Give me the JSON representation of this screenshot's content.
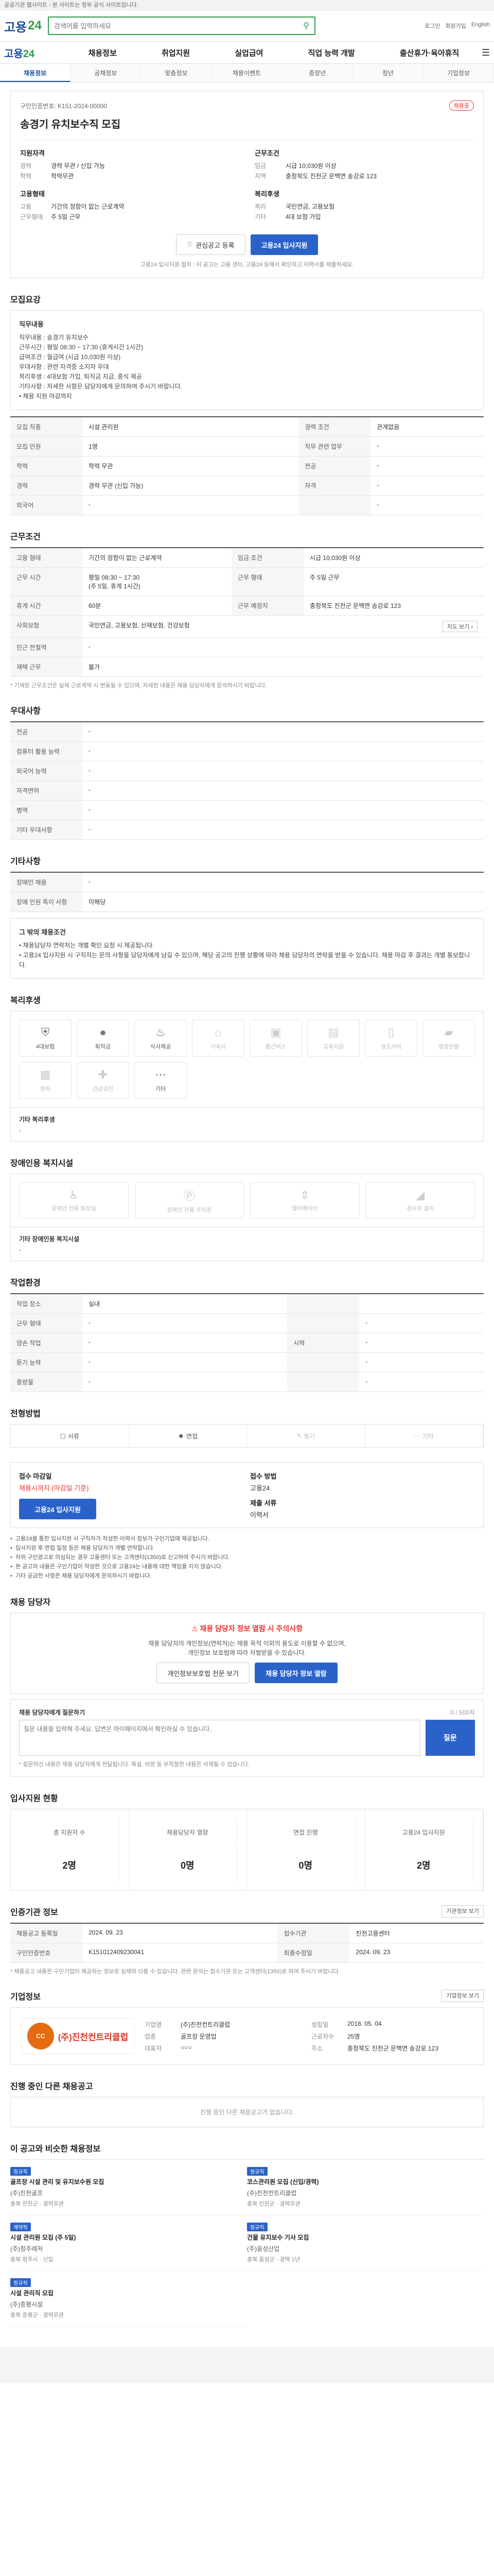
{
  "banner": "공공기관 웹사이트 - 본 사이트는 정부 공식 사이트입니다.",
  "header": {
    "logo_a": "고용",
    "logo_b": "24",
    "search_placeholder": "검색어를 입력하세요",
    "util": [
      "로그인",
      "회원가입",
      "English"
    ]
  },
  "gnb": {
    "items": [
      "채용정보",
      "취업지원",
      "실업급여",
      "직업 능력 개발",
      "출산휴가·육아휴직"
    ]
  },
  "tabs": [
    "채용정보",
    "공채정보",
    "맞춤정보",
    "채용이벤트",
    "중장년",
    "청년",
    "기업정보"
  ],
  "job": {
    "breadcrumb": "구인인증번호: K151-2024-00000",
    "status": "채용중",
    "title": "송경기 유치보수직 모집",
    "left_h": "지원자격",
    "left": [
      [
        "경력",
        "경력 무관 / 신입 가능"
      ],
      [
        "학력",
        "학력무관"
      ]
    ],
    "right_h": "근무조건",
    "right": [
      [
        "임금",
        "시급 10,030원 이상"
      ],
      [
        "지역",
        "충청북도 진천군 문백면 송강로 123"
      ]
    ],
    "left_h2": "고용형태",
    "left2": [
      [
        "고용",
        "기간의 정함이 없는 근로계약"
      ],
      [
        "근무형태",
        "주 5일 근무"
      ]
    ],
    "right_h2": "복리후생",
    "right2": [
      [
        "복리",
        "국민연금, 고용보험"
      ],
      [
        "기타",
        "4대 보험 가입"
      ]
    ],
    "btn_save": "관심공고 등록",
    "btn_apply": "고용24 입사지원",
    "note": "고용24 입사지원 절차 : 이 공고는 고용 센터, 고용24 등에서 확인하고 이력서를 제출하세요."
  },
  "recruit": {
    "title": "모집요강",
    "box_label": "직무내용",
    "box_text": "직무내용 : 송경기 유치보수\n근무시간 : 평일 08:30 ~ 17:30 (휴게시간 1시간)\n급여조건 : 월급여 (시급 10,030원 이상)\n우대사항 : 관련 자격증 소지자 우대\n복리후생 : 4대보험 가입, 퇴직금 지급, 중식 제공\n기타사항 : 자세한 사항은 담당자에게 문의하여 주시기 바랍니다.\n   • 채용 지원 마감까지",
    "rows": [
      [
        "모집 직종",
        "시설 관리원",
        "경력 조건",
        "관계없음"
      ],
      [
        "모집 인원",
        "1명",
        "직무 관련 업무",
        "-"
      ],
      [
        "학력",
        "학력 무관",
        "전공",
        "-"
      ],
      [
        "경력",
        "경력 무관 (신입 가능)",
        "자격",
        "-"
      ],
      [
        "외국어",
        "-",
        "",
        "-"
      ]
    ]
  },
  "work": {
    "title": "근무조건",
    "rows": [
      [
        "고용 형태",
        "기간의 정함이 없는 근로계약",
        "임금 조건",
        "시급 10,030원 이상"
      ],
      [
        "근무 시간",
        "평일 08:30 ~ 17:30\n(주 5일, 휴게 1시간)",
        "근무 형태",
        "주 5일 근무"
      ],
      [
        "휴게 시간",
        "60분",
        "근무 예정지",
        "충청북도 진천군 문백면 송강로 123"
      ],
      [
        "사회보험",
        "국민연금, 고용보험, 산재보험, 건강보험",
        "퇴직급여",
        "퇴직금"
      ],
      [
        "인근 전철역",
        "-",
        "",
        ""
      ],
      [
        "재택 근무",
        "불가",
        "",
        ""
      ]
    ],
    "note": "* 기재된 근무조건은 실제 근로계약 시 변동될 수 있으며, 자세한 내용은 채용 담당자에게 문의하시기 바랍니다."
  },
  "pref": {
    "title": "우대사항",
    "rows": [
      [
        "전공",
        "-"
      ],
      [
        "컴퓨터 활용 능력",
        "-"
      ],
      [
        "외국어 능력",
        "-"
      ],
      [
        "자격면허",
        "-"
      ],
      [
        "병역",
        "-"
      ],
      [
        "기타 우대사항",
        "-"
      ]
    ]
  },
  "etc": {
    "title": "기타사항",
    "rows": [
      [
        "장애인 채용",
        "-"
      ],
      [
        "장애 인원 특이 사항",
        "미해당"
      ]
    ]
  },
  "other": {
    "label": "그 밖의 채용조건",
    "text": "• 채용담당자 연락처는 개별 확인 요청 시 제공됩니다.\n• 고용24 입사지원 시 구직자는 문의 사항을 담당자에게 남길 수 있으며, 해당 공고의 진행 상황에 따라 채용 담당자의 연락을 받을 수 있습니다. 채용 마감 후 결과는 개별 통보합니다."
  },
  "welfare": {
    "title": "복리후생",
    "items": [
      [
        "4대보험",
        "on"
      ],
      [
        "퇴직금",
        "on"
      ],
      [
        "식사제공",
        "on"
      ],
      [
        "기숙사",
        "off"
      ],
      [
        "통근버스",
        "off"
      ],
      [
        "교육지원",
        "off"
      ],
      [
        "경조사비",
        "off"
      ],
      [
        "명절선물",
        "off"
      ],
      [
        "연차",
        "off"
      ],
      [
        "건강검진",
        "off"
      ],
      [
        "기타",
        "on"
      ]
    ],
    "sub_label": "기타 복리후생",
    "sub_text": "-"
  },
  "disability": {
    "title": "장애인용 복지시설",
    "items": [
      "장애인 전용 화장실",
      "장애인 전용 주차장",
      "엘리베이터",
      "경사로 설치"
    ],
    "sub_label": "기타 장애인용 복지시설",
    "sub_text": "-"
  },
  "workenv": {
    "title": "작업환경",
    "rows": [
      [
        "작업 장소",
        "실내",
        "",
        ""
      ],
      [
        "근무 형태",
        "-",
        "",
        "-"
      ],
      [
        "양손 작업",
        "-",
        "시력",
        "-"
      ],
      [
        "듣기 능력",
        "-",
        "",
        "-"
      ],
      [
        "중량물",
        "-",
        "",
        "-"
      ]
    ]
  },
  "process": {
    "title": "전형방법",
    "steps": [
      [
        "서류",
        "on"
      ],
      [
        "면접",
        "on"
      ],
      [
        "필기",
        "off"
      ],
      [
        "기타",
        "off"
      ]
    ]
  },
  "apply": {
    "h1": "접수 마감일",
    "v1": "채용시까지 (마감일 기준)",
    "h2": "접수 방법",
    "v2": "고용24",
    "h3": "제출 서류",
    "v3": "이력서",
    "btn": "고용24 입사지원",
    "notices": [
      "고용24를 통한 입사지원 시 구직자가 작성한 이력서 정보가 구인기업에 제공됩니다.",
      "입사지원 후 면접 일정 등은 채용 담당자가 개별 연락합니다.",
      "허위 구인광고로 의심되는 경우 고용센터 또는 고객센터(1350)로 신고하여 주시기 바랍니다.",
      "본 공고의 내용은 구인기업이 작성한 것으로 고용24는 내용에 대한 책임을 지지 않습니다.",
      "기타 궁금한 사항은 채용 담당자에게 문의하시기 바랍니다."
    ]
  },
  "contact": {
    "title": "채용 담당자",
    "tt": "채용 담당자 정보 열람 시 주의사항",
    "sub": "채용 담당자의 개인정보(연락처)는 채용 목적 이외의 용도로 이용할 수 없으며,\n개인정보 보호법에 따라 처벌받을 수 있습니다.",
    "b1": "개인정보보호법 전문 보기",
    "b2": "채용 담당자 정보 열람"
  },
  "qna": {
    "label": "채용 담당자에게 질문하기",
    "count": "0 / 500자",
    "placeholder": "질문 내용을 입력해 주세요. 답변은 마이페이지에서 확인하실 수 있습니다.",
    "btn": "질문",
    "note": "* 질문하신 내용은 채용 담당자에게 전달됩니다. 욕설, 비방 등 부적절한 내용은 삭제될 수 있습니다."
  },
  "stats": {
    "title": "입사지원 현황",
    "items": [
      [
        "총 지원자 수",
        "2명"
      ],
      [
        "채용담당자 열람",
        "0명"
      ],
      [
        "면접 진행",
        "0명"
      ],
      [
        "고용24 입사지원",
        "2명"
      ]
    ]
  },
  "govinfo": {
    "title": "인증기관 정보",
    "btn": "기관정보 보기",
    "rows": [
      [
        "채용공고 등록일",
        "2024. 09. 23",
        "접수기관",
        "진천고용센터"
      ],
      [
        "구인인증번호",
        "K151012409230041",
        "최종수정일",
        "2024. 09. 23"
      ]
    ],
    "note": "* 채용공고 내용은 구인기업이 제공하는 정보로 실제와 다를 수 있습니다. 관련 문의는 접수기관 또는 고객센터(1350)로 하여 주시기 바랍니다."
  },
  "company": {
    "title": "기업정보",
    "btn": "기업정보 보기",
    "logo": "(주)진천컨트리클럽",
    "info": [
      [
        "기업명",
        "(주)진천컨트리클럽"
      ],
      [
        "업종",
        "골프장 운영업"
      ],
      [
        "대표자",
        "○○○"
      ],
      [
        "설립일",
        "2018. 05. 04"
      ],
      [
        "주소",
        "충청북도 진천군 문백면 송강로 123"
      ],
      [
        "근로자수",
        "25명"
      ]
    ]
  },
  "similar": {
    "title": "진행 중인 다른 채용공고",
    "empty": "진행 중인 다른 채용공고가 없습니다."
  },
  "recommend": {
    "title": "이 공고와 비슷한 채용정보",
    "items": [
      {
        "tag": "정규직",
        "co": "(주)진천골프",
        "title": "골프장 시설 관리 및 유지보수원 모집",
        "loc": "충북 진천군 · 경력무관"
      },
      {
        "tag": "정규직",
        "co": "(주)진천컨트리클럽",
        "title": "코스관리원 모집 (신입/경력)",
        "loc": "충북 진천군 · 경력무관"
      },
      {
        "tag": "계약직",
        "co": "(주)청주레저",
        "title": "시설 관리원 모집 (주 5일)",
        "loc": "충북 청주시 · 신입"
      },
      {
        "tag": "정규직",
        "co": "(주)음성산업",
        "title": "건물 유지보수 기사 모집",
        "loc": "충북 음성군 · 경력 1년"
      },
      {
        "tag": "정규직",
        "co": "(주)증평시설",
        "title": "시설 관리직 모집",
        "loc": "충북 증평군 · 경력무관"
      }
    ]
  }
}
